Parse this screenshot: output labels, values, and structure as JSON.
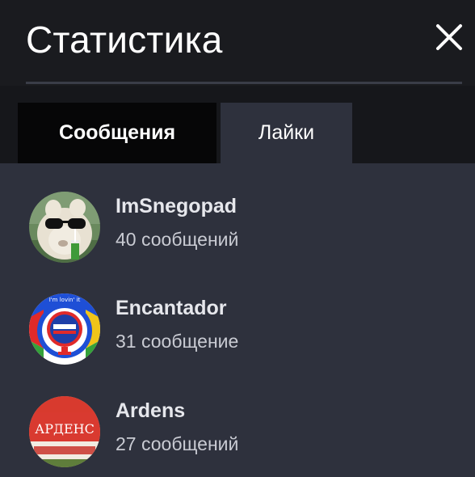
{
  "header": {
    "title": "Статистика",
    "close_icon": "close-icon"
  },
  "tabs": [
    {
      "label": "Сообщения",
      "active": true
    },
    {
      "label": "Лайки",
      "active": false
    }
  ],
  "users": [
    {
      "name": "ImSnegopad",
      "count": "40 сообщений",
      "avatar": "llama-sunglasses-avatar"
    },
    {
      "name": "Encantador",
      "count": "31 сообщение",
      "avatar": "badge-emblem-avatar",
      "avatar_text": "I'm lovin' it"
    },
    {
      "name": "Ardens",
      "count": "27 сообщений",
      "avatar": "red-sign-avatar",
      "avatar_text": "АРДЕНС"
    }
  ],
  "colors": {
    "background": "#2e313d",
    "header": "#1a1b1f",
    "active_tab": "#060607",
    "text": "#ffffff"
  }
}
